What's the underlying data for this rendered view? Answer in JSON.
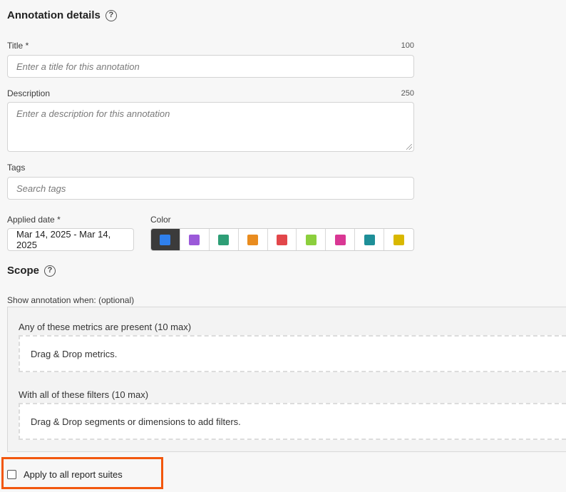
{
  "annotation_details": {
    "heading": "Annotation details",
    "help_glyph": "?",
    "title_field": {
      "label": "Title",
      "required_mark": "*",
      "counter": "100",
      "placeholder": "Enter a title for this annotation"
    },
    "description_field": {
      "label": "Description",
      "counter": "250",
      "placeholder": "Enter a description for this annotation"
    },
    "tags_field": {
      "label": "Tags",
      "placeholder": "Search tags"
    },
    "applied_date": {
      "label": "Applied date",
      "required_mark": "*",
      "value": "Mar 14, 2025 - Mar 14, 2025"
    },
    "color": {
      "label": "Color",
      "selected_index": 0,
      "options": [
        "#2f80ed",
        "#9b59d9",
        "#2e9e76",
        "#e98c1f",
        "#e2474b",
        "#8ccf3d",
        "#d93794",
        "#1e8f98",
        "#d9b800"
      ]
    }
  },
  "scope": {
    "heading": "Scope",
    "help_glyph": "?",
    "show_when_label": "Show annotation when: (optional)",
    "metrics": {
      "label": "Any of these metrics are present (10 max)",
      "dropzone_text": "Drag & Drop metrics."
    },
    "filters": {
      "label": "With all of these filters (10 max)",
      "dropzone_text": "Drag & Drop segments or dimensions to add filters."
    },
    "apply_all": {
      "label": "Apply to all report suites",
      "checked": false,
      "highlight_color": "#f2570d"
    }
  }
}
